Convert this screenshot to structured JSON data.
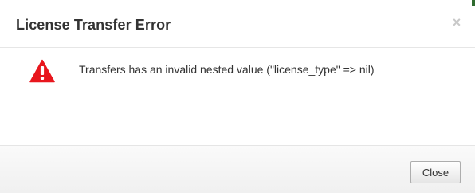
{
  "dialog": {
    "title": "License Transfer Error",
    "close_symbol": "×",
    "message": "Transfers has an invalid nested value (\"license_type\" => nil)",
    "icon": "warning-icon",
    "close_button_label": "Close"
  },
  "colors": {
    "warning_red": "#e8161d",
    "title_text": "#333333",
    "accent_green": "#2f6b2f"
  }
}
